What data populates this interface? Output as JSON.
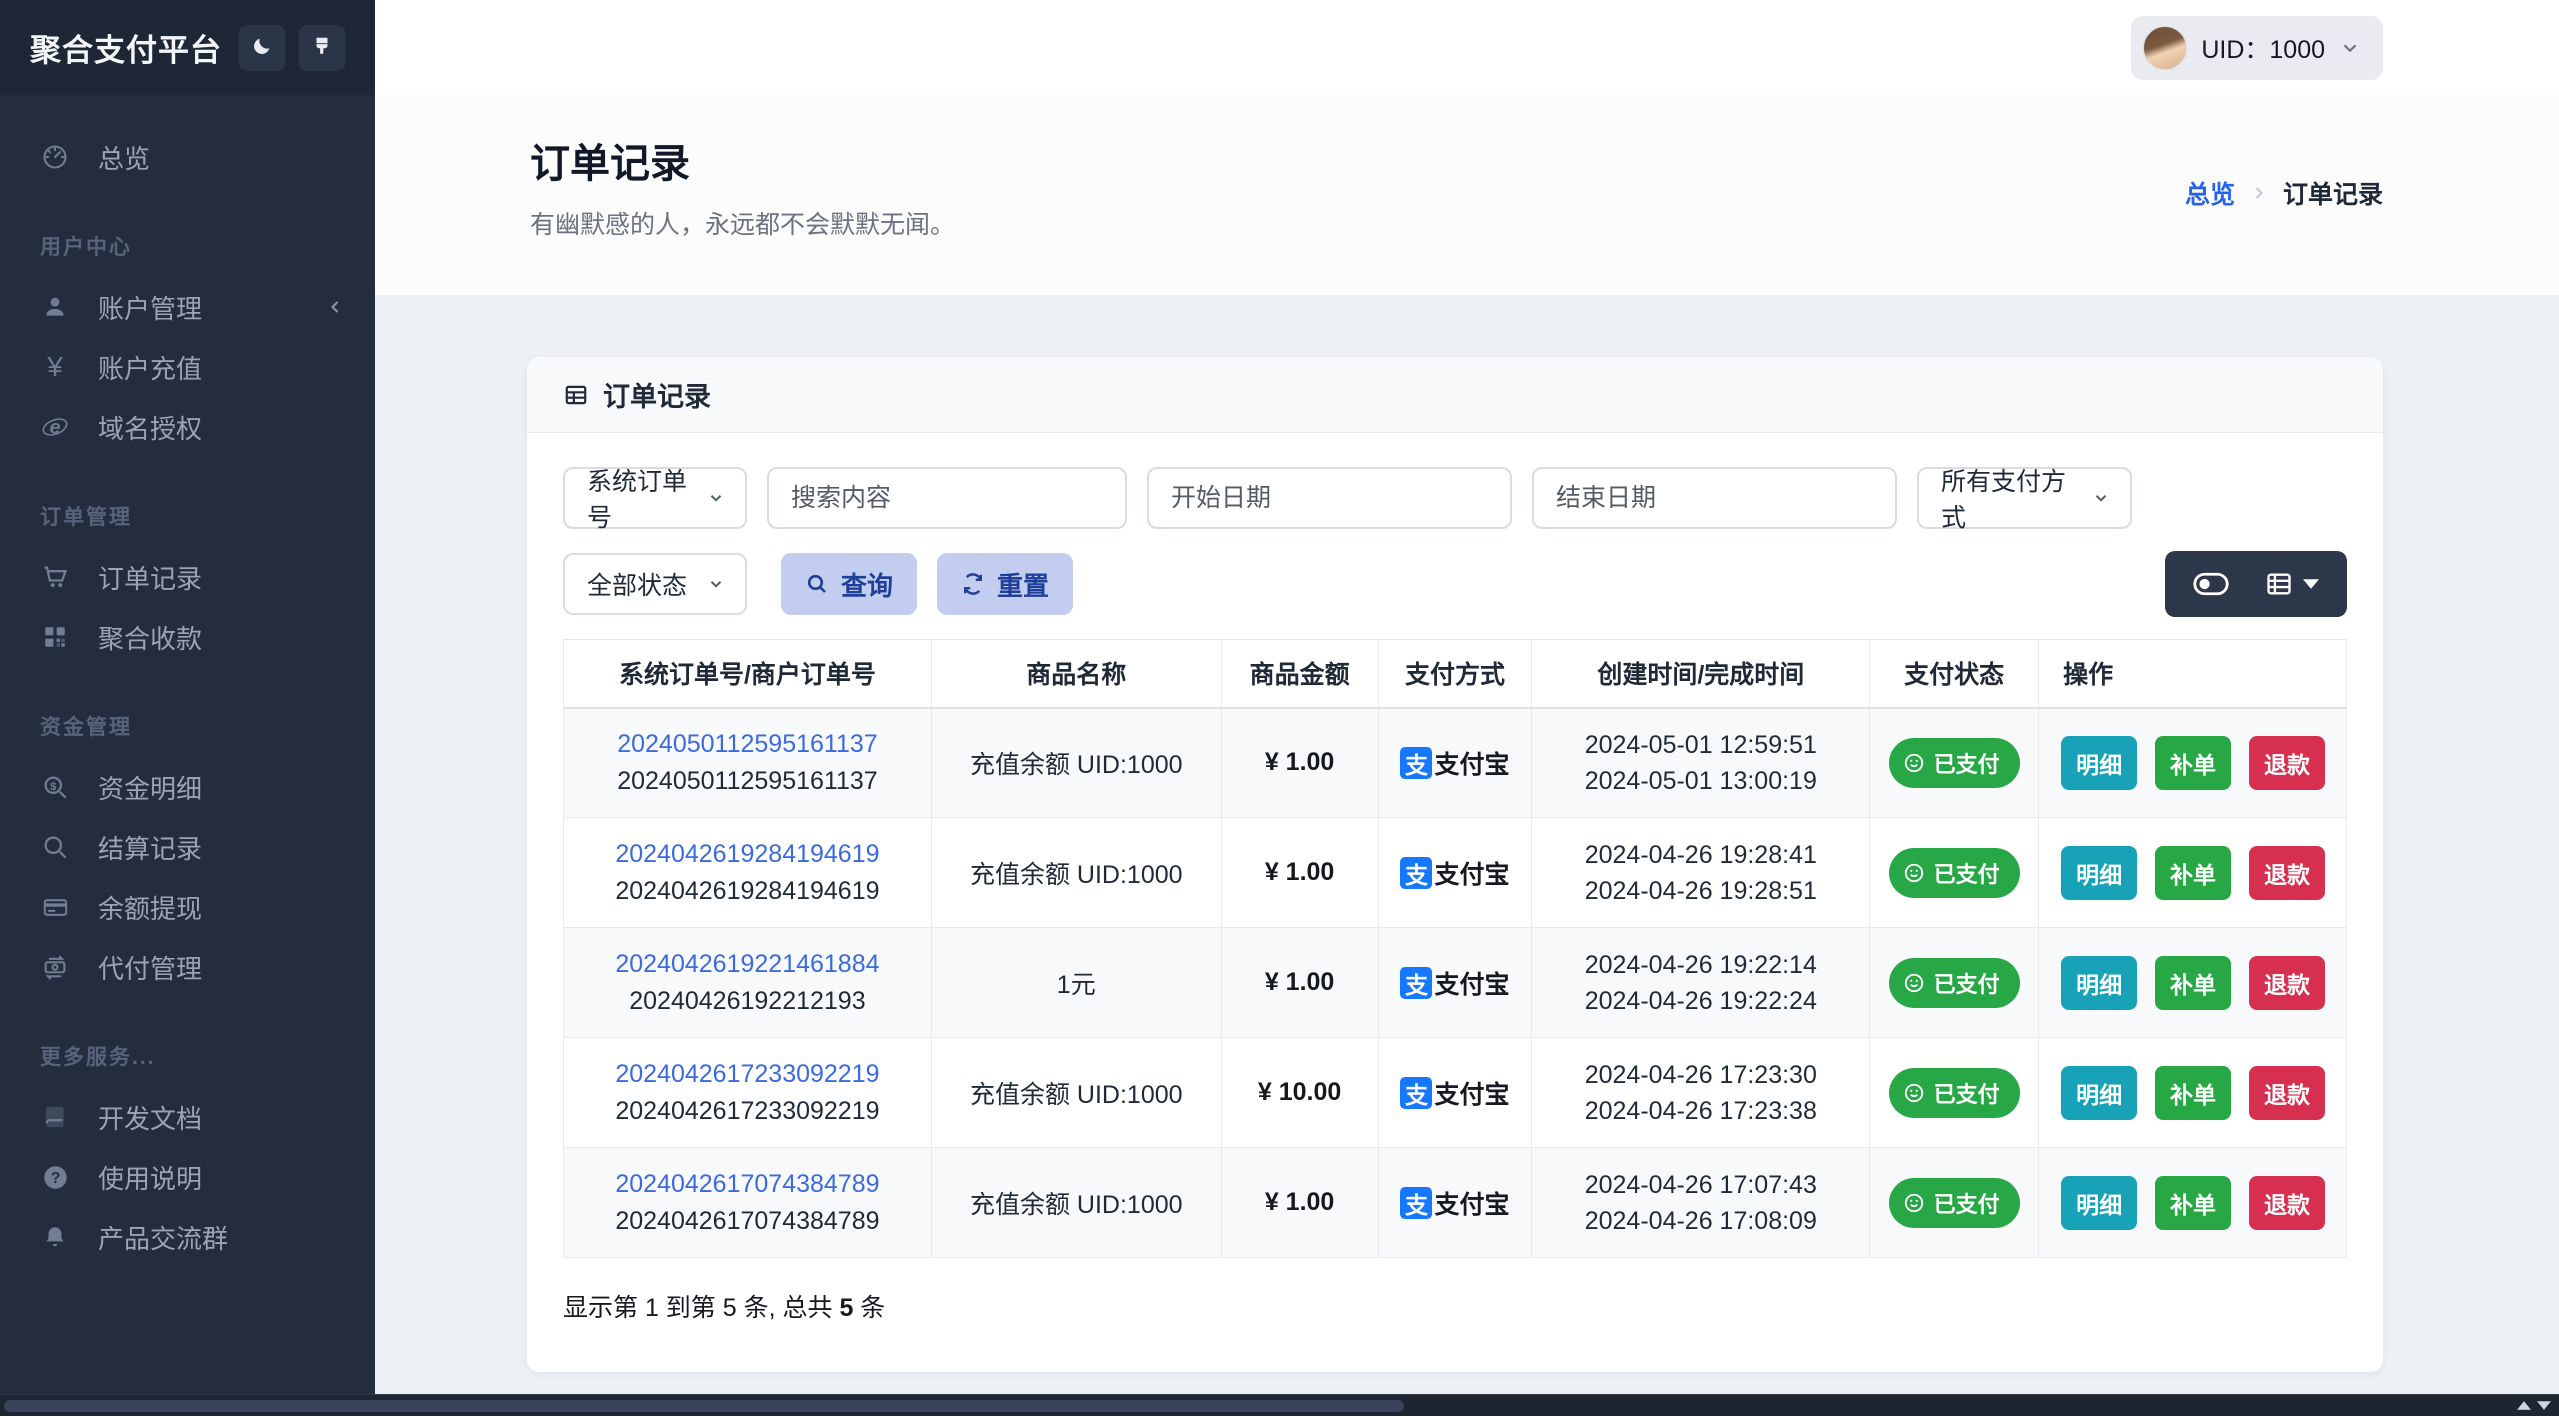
{
  "app": {
    "title": "聚合支付平台"
  },
  "topbar": {
    "uid_label": "UID：1000"
  },
  "sidebar": {
    "sections": [
      {
        "header": "",
        "items": [
          {
            "icon": "dashboard-icon",
            "label": "总览"
          }
        ]
      },
      {
        "header": "用户中心",
        "items": [
          {
            "icon": "user-icon",
            "label": "账户管理",
            "collapsed": true
          },
          {
            "icon": "yen-icon",
            "label": "账户充值"
          },
          {
            "icon": "globe-icon",
            "label": "域名授权"
          }
        ]
      },
      {
        "header": "订单管理",
        "items": [
          {
            "icon": "cart-icon",
            "label": "订单记录"
          },
          {
            "icon": "qrcode-icon",
            "label": "聚合收款"
          }
        ]
      },
      {
        "header": "资金管理",
        "items": [
          {
            "icon": "search-dollar-icon",
            "label": "资金明细"
          },
          {
            "icon": "search-icon",
            "label": "结算记录"
          },
          {
            "icon": "credit-card-icon",
            "label": "余额提现"
          },
          {
            "icon": "money-transfer-icon",
            "label": "代付管理"
          }
        ]
      },
      {
        "header": "更多服务...",
        "items": [
          {
            "icon": "book-icon",
            "label": "开发文档"
          },
          {
            "icon": "question-icon",
            "label": "使用说明"
          },
          {
            "icon": "bell-icon",
            "label": "产品交流群"
          }
        ]
      }
    ]
  },
  "page": {
    "title": "订单记录",
    "subtitle": "有幽默感的人，永远都不会默默无闻。",
    "breadcrumb": {
      "root": "总览",
      "current": "订单记录"
    }
  },
  "card": {
    "title": "订单记录"
  },
  "filters": {
    "order_type_value": "系统订单号",
    "search_placeholder": "搜索内容",
    "start_date_placeholder": "开始日期",
    "end_date_placeholder": "结束日期",
    "payment_method_value": "所有支付方式",
    "status_value": "全部状态",
    "query_label": "查询",
    "reset_label": "重置"
  },
  "table": {
    "headers": [
      "系统订单号/商户订单号",
      "商品名称",
      "商品金额",
      "支付方式",
      "创建时间/完成时间",
      "支付状态",
      "操作"
    ],
    "alipay_glyph": "支",
    "rows": [
      {
        "sys_order": "2024050112595161137",
        "merchant_order": "2024050112595161137",
        "product": "充值余额 UID:1000",
        "amount": "¥ 1.00",
        "method": "支付宝",
        "created": "2024-05-01 12:59:51",
        "completed": "2024-05-01 13:00:19",
        "status": "已支付",
        "actions": [
          "明细",
          "补单",
          "退款"
        ]
      },
      {
        "sys_order": "2024042619284194619",
        "merchant_order": "2024042619284194619",
        "product": "充值余额 UID:1000",
        "amount": "¥ 1.00",
        "method": "支付宝",
        "created": "2024-04-26 19:28:41",
        "completed": "2024-04-26 19:28:51",
        "status": "已支付",
        "actions": [
          "明细",
          "补单",
          "退款"
        ]
      },
      {
        "sys_order": "2024042619221461884",
        "merchant_order": "20240426192212193",
        "product": "1元",
        "amount": "¥ 1.00",
        "method": "支付宝",
        "created": "2024-04-26 19:22:14",
        "completed": "2024-04-26 19:22:24",
        "status": "已支付",
        "actions": [
          "明细",
          "补单",
          "退款"
        ]
      },
      {
        "sys_order": "2024042617233092219",
        "merchant_order": "2024042617233092219",
        "product": "充值余额 UID:1000",
        "amount": "¥ 10.00",
        "method": "支付宝",
        "created": "2024-04-26 17:23:30",
        "completed": "2024-04-26 17:23:38",
        "status": "已支付",
        "actions": [
          "明细",
          "补单",
          "退款"
        ]
      },
      {
        "sys_order": "2024042617074384789",
        "merchant_order": "2024042617074384789",
        "product": "充值余额 UID:1000",
        "amount": "¥ 1.00",
        "method": "支付宝",
        "created": "2024-04-26 17:07:43",
        "completed": "2024-04-26 17:08:09",
        "status": "已支付",
        "actions": [
          "明细",
          "补单",
          "退款"
        ]
      }
    ],
    "footer": {
      "prefix": "显示第 1 到第 5 条, 总共 ",
      "total": "5",
      "suffix": " 条"
    }
  },
  "colors": {
    "sidebar_bg": "#232d3e",
    "sidebar_header_bg": "#1e2735",
    "accent_blue": "#2563eb",
    "link_blue": "#3b6ae0",
    "alipay_blue": "#1677ff",
    "success_green": "#28a746",
    "info_teal": "#17a2b8",
    "danger_red": "#d62f4f",
    "query_button_bg": "#c3cdf0",
    "query_button_text": "#1f3f99",
    "toolbar_dark": "#2c3849"
  }
}
